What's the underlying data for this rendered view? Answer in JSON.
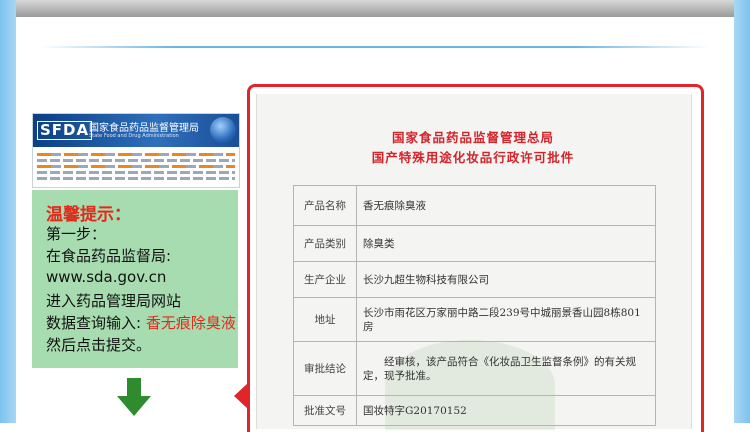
{
  "sfda": {
    "logo": "SFDA",
    "title": "国家食品药品监督管理局",
    "subtitle": "State Food and Drug Administration"
  },
  "tips": {
    "title": "温馨提示：",
    "step": "第一步：",
    "line1": "在食品药品监督局:",
    "url": "www.sda.gov.cn",
    "line2": "进入药品管理局网站",
    "line3_prefix": "数据查询输入: ",
    "line3_highlight": "香无痕除臭液",
    "line4": "然后点击提交。"
  },
  "certificate": {
    "title1": "国家食品药品监督管理总局",
    "title2": "国产特殊用途化妆品行政许可批件",
    "rows": [
      {
        "label": "产品名称",
        "value": "香无痕除臭液"
      },
      {
        "label": "产品类别",
        "value": "除臭类"
      },
      {
        "label": "生产企业",
        "value": "长沙九超生物科技有限公司"
      },
      {
        "label": "地址",
        "value": "长沙市雨花区万家丽中路二段239号中城丽景香山园8栋801房"
      },
      {
        "label": "审批结论",
        "value": "经审核，该产品符合《化妆品卫生监督条例》的有关规定，现予批准。"
      },
      {
        "label": "批准文号",
        "value": "国妆特字G20170152"
      }
    ]
  },
  "colors": {
    "accent_red": "#e0262a",
    "tips_bg": "#a7dcb0",
    "arrow_green": "#2e8b2e"
  }
}
